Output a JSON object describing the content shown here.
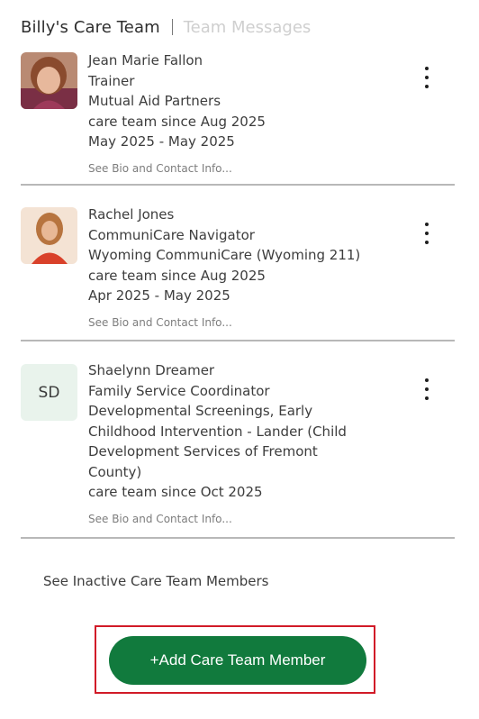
{
  "header": {
    "active_tab": "Billy's Care Team",
    "inactive_tab": "Team Messages"
  },
  "members": [
    {
      "name": "Jean Marie Fallon",
      "role": "Trainer",
      "organization": "Mutual Aid Partners",
      "since": "care team since Aug 2025",
      "dates": "May 2025 - May 2025",
      "bio_link": "See Bio and Contact Info..."
    },
    {
      "name": "Rachel Jones",
      "role": "CommuniCare Navigator",
      "organization": "Wyoming CommuniCare (Wyoming 211)",
      "since": "care team since Aug 2025",
      "dates": "Apr 2025 - May 2025",
      "bio_link": "See Bio and Contact Info..."
    },
    {
      "name": "Shaelynn Dreamer",
      "initials": "SD",
      "role": "Family Service Coordinator",
      "organization_lines": [
        "Developmental Screenings, Early",
        "Childhood Intervention - Lander (Child",
        "Development Services of Fremont",
        "County)"
      ],
      "since": "care team since Oct 2025",
      "bio_link": "See Bio and Contact Info..."
    }
  ],
  "inactive_link": "See Inactive Care Team Members",
  "add_button": "+Add Care Team Member",
  "colors": {
    "primary_green": "#117a3d",
    "highlight_red": "#d11b28",
    "initials_bg": "#e9f3ec",
    "divider": "#b8b8b8"
  }
}
